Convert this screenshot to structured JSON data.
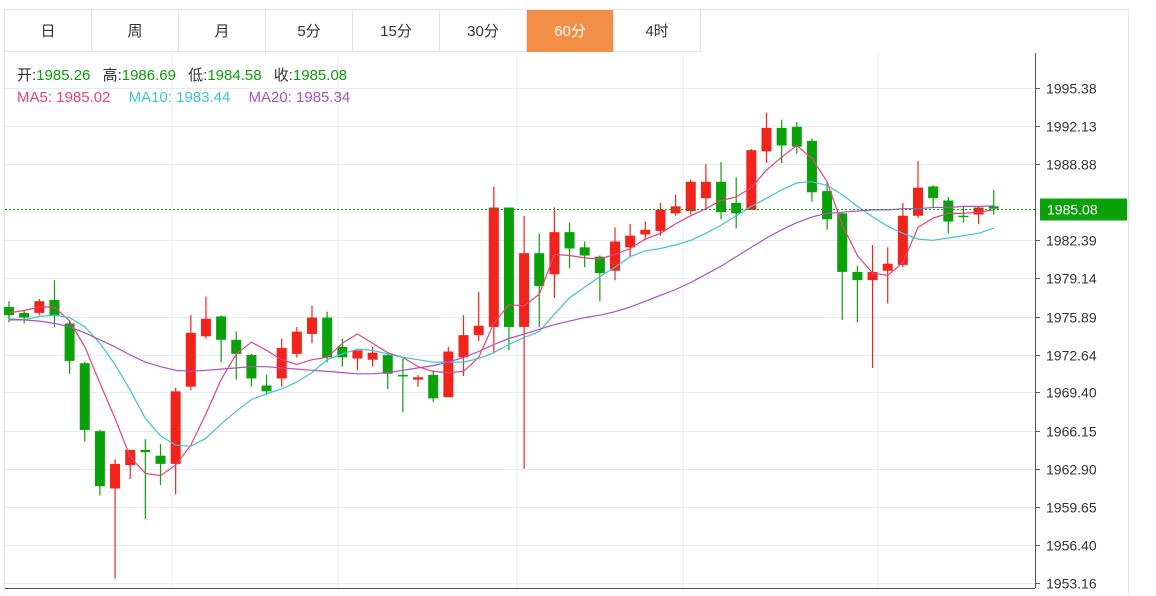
{
  "tabs": [
    {
      "label": "日",
      "active": false
    },
    {
      "label": "周",
      "active": false
    },
    {
      "label": "月",
      "active": false
    },
    {
      "label": "5分",
      "active": false
    },
    {
      "label": "15分",
      "active": false
    },
    {
      "label": "30分",
      "active": false
    },
    {
      "label": "60分",
      "active": true
    },
    {
      "label": "4时",
      "active": false
    }
  ],
  "info": {
    "open_label": "开:",
    "open": "1985.26",
    "high_label": "高:",
    "high": "1986.69",
    "low_label": "低:",
    "low": "1984.58",
    "close_label": "收:",
    "close": "1985.08",
    "ma5": "MA5: 1985.02",
    "ma10": "MA10: 1983.44",
    "ma20": "MA20: 1985.34"
  },
  "colors": {
    "up": "#f2231b",
    "down": "#0aa10a",
    "ma5": "#e8417e",
    "ma10": "#3ec3d6",
    "ma20": "#ae4fc8",
    "active_tab": "#f28e45",
    "price_line": "#0aa10a"
  },
  "chart_data": {
    "type": "candlestick",
    "y_ticks": [
      "1995.38",
      "1992.13",
      "1988.88",
      "1982.39",
      "1979.14",
      "1975.89",
      "1972.64",
      "1969.40",
      "1966.15",
      "1962.90",
      "1959.65",
      "1956.40",
      "1953.16"
    ],
    "ylim": [
      1952.7,
      1998.4
    ],
    "last_price": "1985.08",
    "grid": true,
    "candles": [
      [
        1976.7,
        1976.0,
        1977.2,
        1975.4
      ],
      [
        1976.2,
        1975.8,
        1976.4,
        1975.3
      ],
      [
        1976.2,
        1977.2,
        1977.4,
        1976.0
      ],
      [
        1977.3,
        1976.0,
        1979.0,
        1975.0
      ],
      [
        1975.3,
        1972.1,
        1975.6,
        1971.0
      ],
      [
        1971.9,
        1966.2,
        1972.0,
        1965.2
      ],
      [
        1966.1,
        1961.4,
        1966.2,
        1960.6
      ],
      [
        1961.2,
        1963.3,
        1963.7,
        1953.5
      ],
      [
        1963.2,
        1964.5,
        1964.5,
        1962.0
      ],
      [
        1964.5,
        1964.3,
        1965.4,
        1958.6
      ],
      [
        1964.0,
        1963.3,
        1965.0,
        1961.5
      ],
      [
        1963.3,
        1969.5,
        1969.8,
        1960.7
      ],
      [
        1969.9,
        1974.5,
        1976.0,
        1969.6
      ],
      [
        1974.2,
        1975.7,
        1977.6,
        1974.0
      ],
      [
        1975.9,
        1973.9,
        1976.0,
        1972.0
      ],
      [
        1973.9,
        1972.7,
        1974.6,
        1970.5
      ],
      [
        1972.6,
        1970.6,
        1972.7,
        1969.9
      ],
      [
        1970.0,
        1969.5,
        1970.9,
        1969.2
      ],
      [
        1970.6,
        1973.2,
        1974.0,
        1969.9
      ],
      [
        1972.7,
        1974.6,
        1975.0,
        1972.4
      ],
      [
        1974.4,
        1975.8,
        1976.8,
        1973.6
      ],
      [
        1975.8,
        1972.4,
        1976.3,
        1972.0
      ],
      [
        1973.3,
        1972.4,
        1974.0,
        1971.6
      ],
      [
        1972.3,
        1973.0,
        1973.0,
        1971.3
      ],
      [
        1972.2,
        1972.8,
        1973.3,
        1971.6
      ],
      [
        1972.6,
        1971.0,
        1972.8,
        1969.7
      ],
      [
        1970.9,
        1970.8,
        1972.3,
        1967.7
      ],
      [
        1970.5,
        1970.7,
        1970.9,
        1969.9
      ],
      [
        1970.9,
        1968.9,
        1971.3,
        1968.6
      ],
      [
        1969.0,
        1972.9,
        1973.3,
        1969.0
      ],
      [
        1972.4,
        1974.3,
        1976.0,
        1970.8
      ],
      [
        1974.3,
        1975.1,
        1978.0,
        1973.8
      ],
      [
        1975.0,
        1985.2,
        1987.0,
        1972.8
      ],
      [
        1985.2,
        1975.0,
        1985.2,
        1973.0
      ],
      [
        1975.0,
        1981.3,
        1984.5,
        1962.9
      ],
      [
        1981.3,
        1978.5,
        1983.0,
        1975.0
      ],
      [
        1979.5,
        1983.1,
        1985.2,
        1977.5
      ],
      [
        1983.1,
        1981.7,
        1983.9,
        1980.0
      ],
      [
        1981.8,
        1981.1,
        1982.3,
        1980.1
      ],
      [
        1981.0,
        1979.6,
        1981.1,
        1977.2
      ],
      [
        1979.8,
        1982.3,
        1983.5,
        1979.0
      ],
      [
        1981.8,
        1982.8,
        1983.8,
        1981.0
      ],
      [
        1982.9,
        1983.3,
        1984.0,
        1982.4
      ],
      [
        1983.2,
        1985.0,
        1985.6,
        1982.8
      ],
      [
        1984.7,
        1985.3,
        1986.3,
        1984.5
      ],
      [
        1984.9,
        1987.4,
        1987.6,
        1984.6
      ],
      [
        1986.0,
        1987.4,
        1988.9,
        1985.0
      ],
      [
        1987.4,
        1984.8,
        1989.1,
        1984.2
      ],
      [
        1985.6,
        1984.7,
        1987.8,
        1983.4
      ],
      [
        1985.0,
        1990.1,
        1990.2,
        1985.0
      ],
      [
        1990.0,
        1992.0,
        1993.3,
        1989.0
      ],
      [
        1992.0,
        1990.5,
        1992.7,
        1989.0
      ],
      [
        1992.1,
        1990.4,
        1992.5,
        1989.8
      ],
      [
        1990.9,
        1986.5,
        1991.1,
        1985.7
      ],
      [
        1986.6,
        1984.2,
        1987.4,
        1983.3
      ],
      [
        1984.7,
        1979.7,
        1984.8,
        1975.6
      ],
      [
        1979.7,
        1979.0,
        1980.2,
        1975.4
      ],
      [
        1979.0,
        1979.7,
        1982.0,
        1971.5
      ],
      [
        1979.8,
        1980.4,
        1981.8,
        1977.0
      ],
      [
        1980.3,
        1984.5,
        1985.6,
        1980.1
      ],
      [
        1984.5,
        1986.9,
        1989.2,
        1984.3
      ],
      [
        1987.0,
        1986.0,
        1987.1,
        1985.2
      ],
      [
        1985.8,
        1984.0,
        1986.1,
        1983.0
      ],
      [
        1984.5,
        1984.4,
        1985.3,
        1983.9
      ],
      [
        1984.6,
        1985.2,
        1985.3,
        1983.8
      ],
      [
        1985.3,
        1985.1,
        1986.7,
        1984.6
      ]
    ],
    "series": [
      {
        "name": "MA5",
        "values": [
          1976.2,
          1976.4,
          1976.7,
          1976.7,
          1975.5,
          1973.3,
          1970.2,
          1967.2,
          1963.9,
          1962.5,
          1962.3,
          1963.2,
          1964.9,
          1967.6,
          1970.5,
          1972.7,
          1973.7,
          1973.0,
          1972.2,
          1971.8,
          1972.2,
          1972.4,
          1973.6,
          1974.4,
          1973.6,
          1972.8,
          1972.4,
          1971.6,
          1971.2,
          1971.1,
          1971.2,
          1972.4,
          1975.3,
          1976.9,
          1976.8,
          1977.8,
          1981.2,
          1981.1,
          1980.9,
          1980.8,
          1981.2,
          1981.7,
          1982.5,
          1983.0,
          1983.8,
          1984.5,
          1985.1,
          1985.8,
          1986.1,
          1986.9,
          1988.4,
          1989.5,
          1990.5,
          1989.4,
          1987.4,
          1983.7,
          1981.1,
          1979.6,
          1979.4,
          1980.5,
          1983.5,
          1984.3,
          1984.7,
          1984.7,
          1984.8,
          1985.0
        ]
      },
      {
        "name": "MA10",
        "values": [
          1975.7,
          1975.6,
          1975.9,
          1976.0,
          1975.8,
          1975.0,
          1973.6,
          1971.8,
          1969.6,
          1967.2,
          1965.7,
          1964.9,
          1964.8,
          1965.5,
          1966.7,
          1967.8,
          1968.8,
          1969.3,
          1969.7,
          1970.3,
          1971.1,
          1972.2,
          1972.7,
          1973.1,
          1973.0,
          1972.7,
          1972.4,
          1972.2,
          1972.0,
          1972.0,
          1972.0,
          1972.3,
          1972.8,
          1973.5,
          1974.1,
          1974.6,
          1976.1,
          1977.5,
          1978.4,
          1979.3,
          1980.1,
          1981.0,
          1981.5,
          1981.7,
          1982.0,
          1982.4,
          1983.0,
          1983.7,
          1984.5,
          1985.3,
          1986.0,
          1986.7,
          1987.3,
          1987.4,
          1987.1,
          1986.3,
          1985.3,
          1984.4,
          1983.6,
          1983.0,
          1982.5,
          1982.4,
          1982.6,
          1982.8,
          1983.0,
          1983.44
        ]
      },
      {
        "name": "MA20",
        "values": [
          1975.6,
          1975.6,
          1975.5,
          1975.3,
          1975.0,
          1974.5,
          1973.9,
          1973.3,
          1972.6,
          1972.0,
          1971.6,
          1971.3,
          1971.2,
          1971.3,
          1971.4,
          1971.5,
          1971.6,
          1971.6,
          1971.5,
          1971.4,
          1971.3,
          1971.2,
          1971.1,
          1971.0,
          1971.0,
          1971.1,
          1971.3,
          1971.5,
          1971.7,
          1972.0,
          1972.4,
          1972.9,
          1973.5,
          1974.0,
          1974.4,
          1974.8,
          1975.2,
          1975.5,
          1975.8,
          1976.0,
          1976.3,
          1976.7,
          1977.2,
          1977.7,
          1978.2,
          1978.8,
          1979.5,
          1980.2,
          1981.0,
          1981.8,
          1982.6,
          1983.3,
          1983.9,
          1984.4,
          1984.7,
          1984.8,
          1984.9,
          1985.0,
          1985.0,
          1985.1,
          1985.1,
          1985.2,
          1985.2,
          1985.3,
          1985.3,
          1985.34
        ]
      }
    ]
  }
}
